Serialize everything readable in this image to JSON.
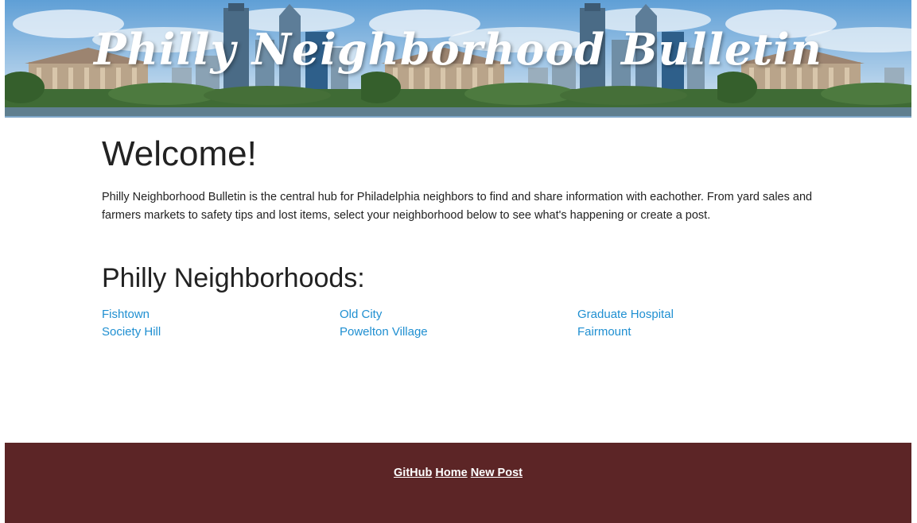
{
  "header": {
    "title": "Philly Neighborhood Bulletin"
  },
  "welcome": {
    "heading": "Welcome!",
    "intro": "Philly Neighborhood Bulletin is the central hub for Philadelphia neighbors to find and share information with eachother. From yard sales and farmers markets to safety tips and lost items, select your neighborhood below to see what's happening or create a post."
  },
  "neighborhoods": {
    "heading": "Philly Neighborhoods:",
    "items": [
      {
        "label": "Fishtown"
      },
      {
        "label": "Old City"
      },
      {
        "label": "Graduate Hospital"
      },
      {
        "label": "Society Hill"
      },
      {
        "label": "Powelton Village"
      },
      {
        "label": "Fairmount"
      }
    ]
  },
  "footer": {
    "links": [
      {
        "label": "GitHub"
      },
      {
        "label": "Home"
      },
      {
        "label": "New Post"
      }
    ]
  },
  "colors": {
    "link": "#1f8fd1",
    "footer_bg": "#5c2526",
    "footer_link": "#ffffff"
  }
}
